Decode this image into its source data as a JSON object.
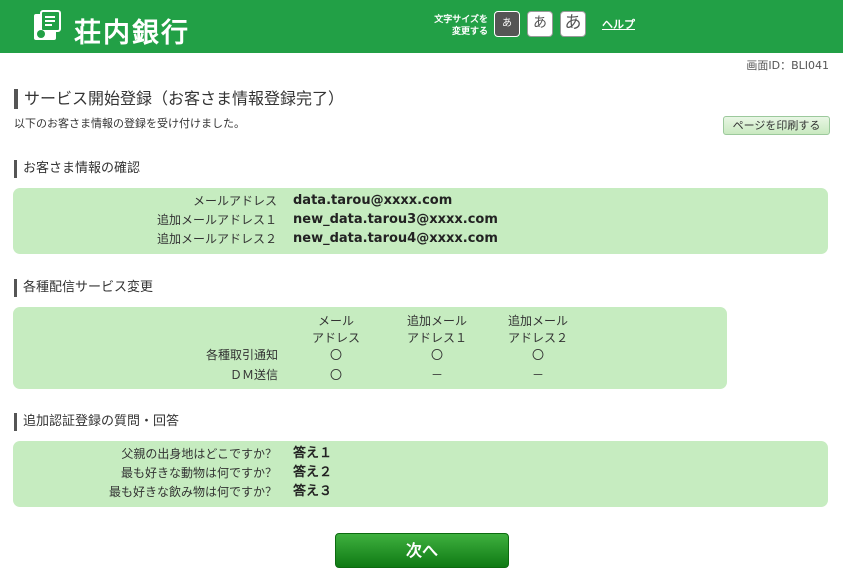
{
  "header": {
    "bank_name": "荘内銀行",
    "font_size_label_1": "文字サイズを",
    "font_size_label_2": "変更する",
    "font_small": "あ",
    "font_medium": "あ",
    "font_large": "あ",
    "help": "ヘルプ"
  },
  "screen_id": "画面ID：BLI041",
  "page": {
    "title": "サービス開始登録（お客さま情報登録完了）",
    "description": "以下のお客さま情報の登録を受け付けました。",
    "print_button": "ページを印刷する"
  },
  "customer_info": {
    "title": "お客さま情報の確認",
    "rows": [
      {
        "label": "メールアドレス",
        "value": "data.tarou@xxxx.com"
      },
      {
        "label": "追加メールアドレス１",
        "value": "new_data.tarou3@xxxx.com"
      },
      {
        "label": "追加メールアドレス２",
        "value": "new_data.tarou4@xxxx.com"
      }
    ]
  },
  "delivery": {
    "title": "各種配信サービス変更",
    "columns": [
      {
        "line1": "メール",
        "line2": "アドレス"
      },
      {
        "line1": "追加メール",
        "line2": "アドレス１"
      },
      {
        "line1": "追加メール",
        "line2": "アドレス２"
      }
    ],
    "rows": [
      {
        "label": "各種取引通知",
        "cells": [
          "〇",
          "〇",
          "〇"
        ]
      },
      {
        "label": "ＤＭ送信",
        "cells": [
          "〇",
          "－",
          "－"
        ]
      }
    ]
  },
  "auth": {
    "title": "追加認証登録の質問・回答",
    "rows": [
      {
        "label": "父親の出身地はどこですか？",
        "value": "答え１"
      },
      {
        "label": "最も好きな動物は何ですか？",
        "value": "答え２"
      },
      {
        "label": "最も好きな飲み物は何ですか？",
        "value": "答え３"
      }
    ]
  },
  "next_button": "次へ",
  "colors": {
    "brand_green": "#22a046",
    "panel_green": "#c6ecc0",
    "button_green": "#1f8f22"
  }
}
